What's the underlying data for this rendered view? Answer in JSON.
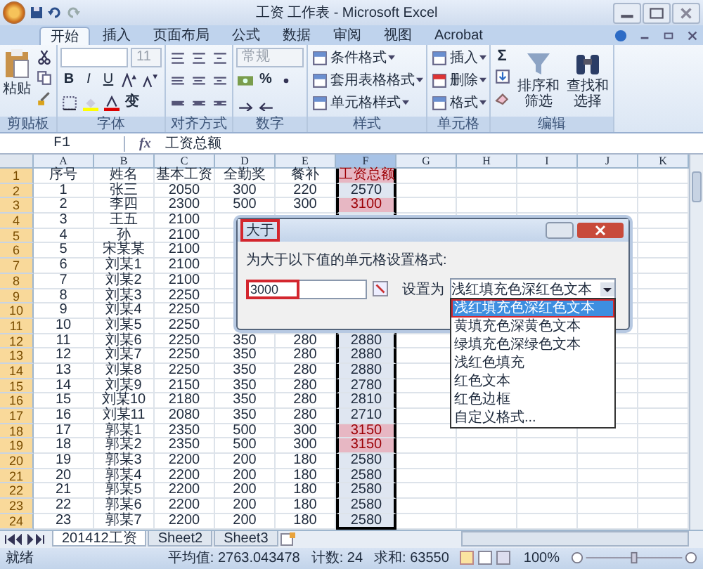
{
  "title_bar": {
    "title": "工资 工作表 - Microsoft Excel"
  },
  "ribbon": {
    "tabs": [
      {
        "label": "开始",
        "selected": true
      },
      {
        "label": "插入",
        "selected": false
      },
      {
        "label": "页面布局",
        "selected": false
      },
      {
        "label": "公式",
        "selected": false
      },
      {
        "label": "数据",
        "selected": false
      },
      {
        "label": "审阅",
        "selected": false
      },
      {
        "label": "视图",
        "selected": false
      },
      {
        "label": "Acrobat",
        "selected": false
      }
    ],
    "groups": [
      {
        "kind": "clipboard",
        "label": "剪贴板",
        "paste": "粘贴"
      },
      {
        "kind": "font",
        "label": "字体",
        "font_size": "11",
        "style_buttons": [
          "B",
          "I",
          "U"
        ],
        "phonetic": "变"
      },
      {
        "kind": "alignment",
        "label": "对齐方式"
      },
      {
        "kind": "number",
        "label": "数字",
        "format": "常规",
        "percent": "%"
      },
      {
        "kind": "styles",
        "label": "样式",
        "commands": [
          "条件格式",
          "套用表格格式",
          "单元格样式"
        ]
      },
      {
        "kind": "cells",
        "label": "单元格",
        "commands": [
          "插入",
          "删除",
          "格式"
        ]
      },
      {
        "kind": "editing",
        "label": "编辑",
        "sum": "Σ",
        "commands": [
          "排序和筛选",
          "查找和选择"
        ]
      }
    ]
  },
  "formula_bar": {
    "name_box": "F1",
    "function_label": "fx",
    "formula": "工资总额"
  },
  "sheet": {
    "columns": [
      {
        "label": "A",
        "selected": false
      },
      {
        "label": "B",
        "selected": false
      },
      {
        "label": "C",
        "selected": false
      },
      {
        "label": "D",
        "selected": false
      },
      {
        "label": "E",
        "selected": false
      },
      {
        "label": "F",
        "selected": true
      },
      {
        "label": "G",
        "selected": false
      },
      {
        "label": "H",
        "selected": false
      },
      {
        "label": "I",
        "selected": false
      },
      {
        "label": "J",
        "selected": false
      },
      {
        "label": "K",
        "selected": false
      }
    ],
    "rows": [
      {
        "label": "1",
        "selected": true,
        "cells": [
          "序号",
          "姓名",
          "基本工资",
          "全勤奖",
          "餐补",
          "工资总额"
        ],
        "total_highlighted": true
      },
      {
        "label": "2",
        "selected": true,
        "cells": [
          "1",
          "张三",
          "2050",
          "300",
          "220",
          "2570"
        ],
        "total_highlighted": false
      },
      {
        "label": "3",
        "selected": true,
        "cells": [
          "2",
          "李四",
          "2300",
          "500",
          "300",
          "3100"
        ],
        "total_highlighted": true
      },
      {
        "label": "4",
        "selected": true,
        "cells": [
          "3",
          "王五",
          "2100"
        ],
        "total_highlighted": false
      },
      {
        "label": "5",
        "selected": true,
        "cells": [
          "4",
          "孙",
          "2100"
        ],
        "total_highlighted": false
      },
      {
        "label": "6",
        "selected": true,
        "cells": [
          "5",
          "宋某某",
          "2100"
        ],
        "total_highlighted": false
      },
      {
        "label": "7",
        "selected": true,
        "cells": [
          "6",
          "刘某1",
          "2100"
        ],
        "total_highlighted": false
      },
      {
        "label": "8",
        "selected": true,
        "cells": [
          "7",
          "刘某2",
          "2100"
        ],
        "total_highlighted": false
      },
      {
        "label": "9",
        "selected": true,
        "cells": [
          "8",
          "刘某3",
          "2250"
        ],
        "total_highlighted": false
      },
      {
        "label": "10",
        "selected": true,
        "cells": [
          "9",
          "刘某4",
          "2250"
        ],
        "total_highlighted": false
      },
      {
        "label": "11",
        "selected": true,
        "cells": [
          "10",
          "刘某5",
          "2250"
        ],
        "total_highlighted": false
      },
      {
        "label": "12",
        "selected": true,
        "cells": [
          "11",
          "刘某6",
          "2250",
          "350",
          "280",
          "2880"
        ],
        "total_highlighted": false
      },
      {
        "label": "13",
        "selected": true,
        "cells": [
          "12",
          "刘某7",
          "2250",
          "350",
          "280",
          "2880"
        ],
        "total_highlighted": false
      },
      {
        "label": "14",
        "selected": true,
        "cells": [
          "13",
          "刘某8",
          "2250",
          "350",
          "280",
          "2880"
        ],
        "total_highlighted": false
      },
      {
        "label": "15",
        "selected": true,
        "cells": [
          "14",
          "刘某9",
          "2150",
          "350",
          "280",
          "2780"
        ],
        "total_highlighted": false
      },
      {
        "label": "16",
        "selected": true,
        "cells": [
          "15",
          "刘某10",
          "2180",
          "350",
          "280",
          "2810"
        ],
        "total_highlighted": false
      },
      {
        "label": "17",
        "selected": true,
        "cells": [
          "16",
          "刘某11",
          "2080",
          "350",
          "280",
          "2710"
        ],
        "total_highlighted": false
      },
      {
        "label": "18",
        "selected": true,
        "cells": [
          "17",
          "郭某1",
          "2350",
          "500",
          "300",
          "3150"
        ],
        "total_highlighted": true
      },
      {
        "label": "19",
        "selected": true,
        "cells": [
          "18",
          "郭某2",
          "2350",
          "500",
          "300",
          "3150"
        ],
        "total_highlighted": true
      },
      {
        "label": "20",
        "selected": true,
        "cells": [
          "19",
          "郭某3",
          "2200",
          "200",
          "180",
          "2580"
        ],
        "total_highlighted": false
      },
      {
        "label": "21",
        "selected": true,
        "cells": [
          "20",
          "郭某4",
          "2200",
          "200",
          "180",
          "2580"
        ],
        "total_highlighted": false
      },
      {
        "label": "22",
        "selected": true,
        "cells": [
          "21",
          "郭某5",
          "2200",
          "200",
          "180",
          "2580"
        ],
        "total_highlighted": false
      },
      {
        "label": "23",
        "selected": true,
        "cells": [
          "22",
          "郭某6",
          "2200",
          "200",
          "180",
          "2580"
        ],
        "total_highlighted": false
      },
      {
        "label": "24",
        "selected": true,
        "cells": [
          "23",
          "郭某7",
          "2200",
          "200",
          "180",
          "2580"
        ],
        "total_highlighted": false
      }
    ]
  },
  "dialog": {
    "title": "大于",
    "title_annotated": true,
    "prompt": "为大于以下值的单元格设置格式:",
    "value": "3000",
    "value_annotated": true,
    "format_label": "设置为",
    "format_value": "浅红填充色深红色文本",
    "options": [
      {
        "label": "浅红填充色深红色文本",
        "selected": true,
        "annotated": true
      },
      {
        "label": "黄填充色深黄色文本",
        "selected": false,
        "annotated": false
      },
      {
        "label": "绿填充色深绿色文本",
        "selected": false,
        "annotated": false
      },
      {
        "label": "浅红色填充",
        "selected": false,
        "annotated": false
      },
      {
        "label": "红色文本",
        "selected": false,
        "annotated": false
      },
      {
        "label": "红色边框",
        "selected": false,
        "annotated": false
      },
      {
        "label": "自定义格式...",
        "selected": false,
        "annotated": false
      }
    ]
  },
  "sheet_tabs": [
    {
      "label": "201412工资",
      "selected": true
    },
    {
      "label": "Sheet2",
      "selected": false
    },
    {
      "label": "Sheet3",
      "selected": false
    }
  ],
  "status_bar": {
    "status": "就绪",
    "average": "平均值: 2763.043478",
    "count": "计数: 24",
    "sum": "求和: 63550",
    "zoom": "100%",
    "zoom_slider": {
      "level": 0.5
    }
  }
}
